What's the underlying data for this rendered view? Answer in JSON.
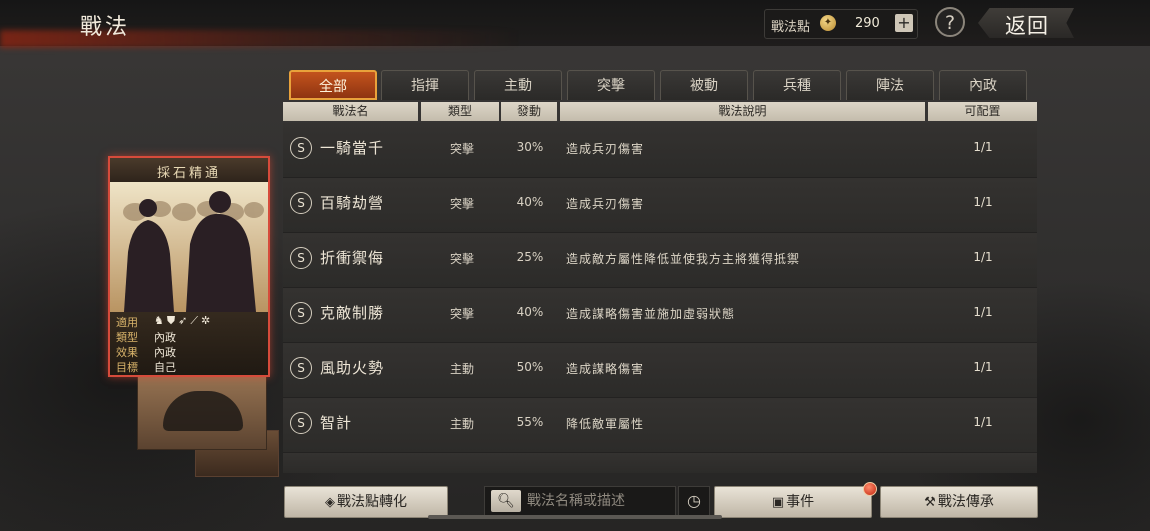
{
  "header": {
    "title": "戰法",
    "points_label": "戰法點",
    "points_icon_glyph": "✦",
    "points_value": "290",
    "plus_label": "+",
    "help_label": "?",
    "back_label": "返回"
  },
  "tabs": [
    {
      "label": "全部",
      "active": true
    },
    {
      "label": "指揮",
      "active": false
    },
    {
      "label": "主動",
      "active": false
    },
    {
      "label": "突擊",
      "active": false
    },
    {
      "label": "被動",
      "active": false
    },
    {
      "label": "兵種",
      "active": false
    },
    {
      "label": "陣法",
      "active": false
    },
    {
      "label": "內政",
      "active": false
    }
  ],
  "columns": {
    "name": "戰法名",
    "type": "類型",
    "rate": "發動",
    "desc": "戰法說明",
    "slots": "可配置"
  },
  "rows": [
    {
      "grade": "S",
      "name": "一騎當千",
      "type": "突擊",
      "rate": "30%",
      "desc": "造成兵刃傷害",
      "slots": "1/1"
    },
    {
      "grade": "S",
      "name": "百騎劫營",
      "type": "突擊",
      "rate": "40%",
      "desc": "造成兵刃傷害",
      "slots": "1/1"
    },
    {
      "grade": "S",
      "name": "折衝禦侮",
      "type": "突擊",
      "rate": "25%",
      "desc": "造成敵方屬性降低並使我方主將獲得抵禦",
      "slots": "1/1"
    },
    {
      "grade": "S",
      "name": "克敵制勝",
      "type": "突擊",
      "rate": "40%",
      "desc": "造成謀略傷害並施加虛弱狀態",
      "slots": "1/1"
    },
    {
      "grade": "S",
      "name": "風助火勢",
      "type": "主動",
      "rate": "50%",
      "desc": "造成謀略傷害",
      "slots": "1/1"
    },
    {
      "grade": "S",
      "name": "智計",
      "type": "主動",
      "rate": "55%",
      "desc": "降低敵軍屬性",
      "slots": "1/1"
    }
  ],
  "card": {
    "title": "採石精通",
    "info": [
      {
        "label": "適用",
        "value": ""
      },
      {
        "label": "類型",
        "value": "內政"
      },
      {
        "label": "效果",
        "value": "內政"
      },
      {
        "label": "目標",
        "value": "自己"
      }
    ],
    "unit_icons": [
      "cavalry-icon",
      "shield-icon",
      "bow-icon",
      "spear-icon",
      "wheel-icon"
    ]
  },
  "bottom": {
    "convert_label": "戰法點轉化",
    "search_placeholder": "戰法名稱或描述",
    "events_label": "事件",
    "inherit_label": "戰法傳承"
  },
  "colors": {
    "accent": "#c3531d",
    "card_border": "#d64b3b",
    "notify": "#c1250f"
  }
}
